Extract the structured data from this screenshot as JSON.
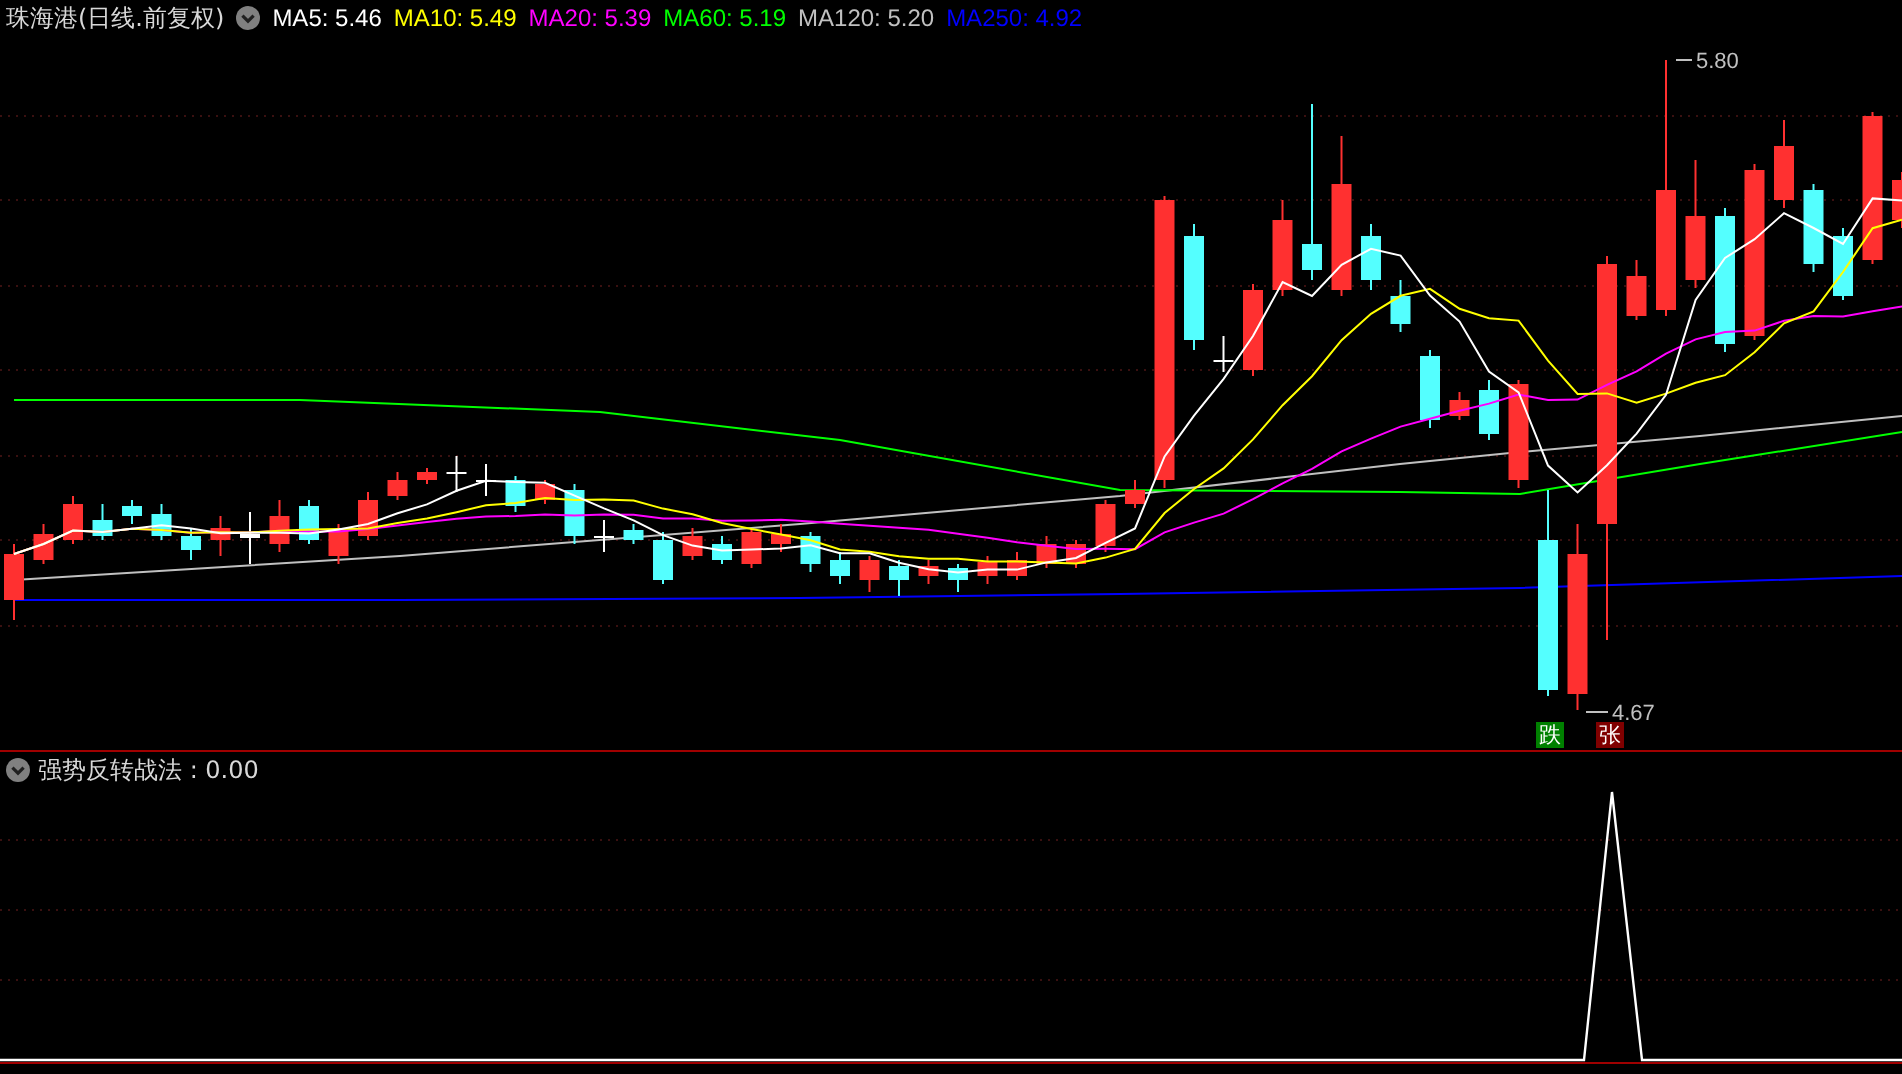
{
  "header": {
    "title": "珠海港(日线.前复权)",
    "ma": [
      {
        "label": "MA5: 5.46",
        "color": "#ffffff"
      },
      {
        "label": "MA10: 5.49",
        "color": "#ffff00"
      },
      {
        "label": "MA20: 5.39",
        "color": "#ff00ff"
      },
      {
        "label": "MA60: 5.19",
        "color": "#00ff00"
      },
      {
        "label": "MA120: 5.20",
        "color": "#c0c0c0"
      },
      {
        "label": "MA250: 4.92",
        "color": "#0000ff"
      }
    ]
  },
  "price_chart": {
    "high_label": "5.80",
    "low_label": "4.67",
    "signals": [
      {
        "text": "跌",
        "color": "#008000"
      },
      {
        "text": "张",
        "color": "#800000"
      }
    ]
  },
  "indicator": {
    "title": "强势反转战法 : 0.00"
  }
}
